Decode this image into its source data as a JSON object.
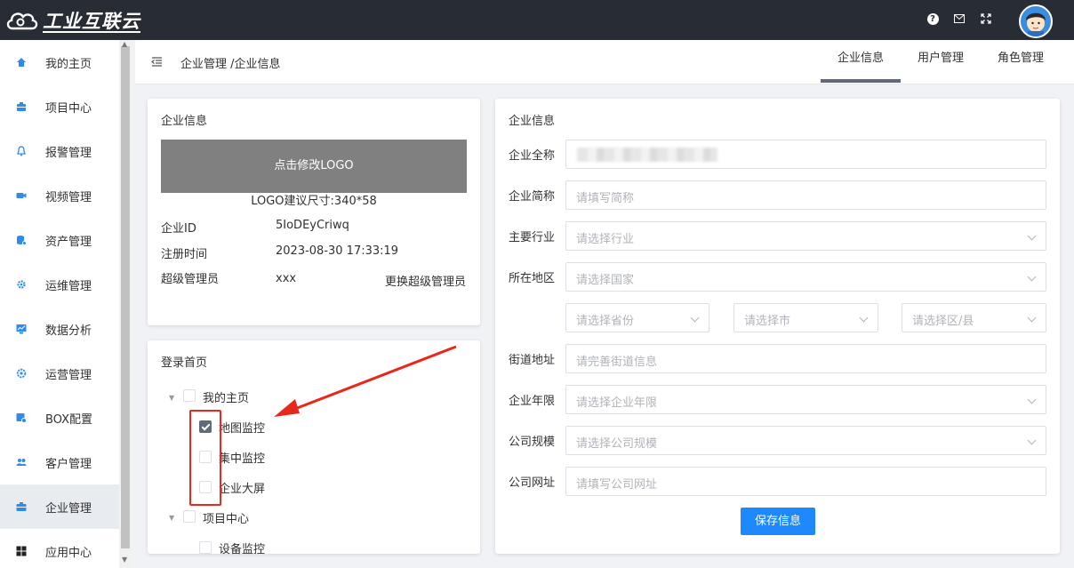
{
  "topbar": {
    "brand": "工业互联云",
    "icons": [
      "help-icon",
      "mail-icon",
      "fullscreen-icon"
    ]
  },
  "sidebar": {
    "items": [
      {
        "label": "我的主页",
        "icon": "home-icon"
      },
      {
        "label": "项目中心",
        "icon": "briefcase-icon"
      },
      {
        "label": "报警管理",
        "icon": "bell-icon"
      },
      {
        "label": "视频管理",
        "icon": "video-icon"
      },
      {
        "label": "资产管理",
        "icon": "database-icon"
      },
      {
        "label": "运维管理",
        "icon": "gear-icon"
      },
      {
        "label": "数据分析",
        "icon": "chart-icon"
      },
      {
        "label": "运营管理",
        "icon": "settings-icon"
      },
      {
        "label": "BOX配置",
        "icon": "box-icon"
      },
      {
        "label": "客户管理",
        "icon": "users-icon"
      },
      {
        "label": "企业管理",
        "icon": "company-icon"
      },
      {
        "label": "应用中心",
        "icon": "grid-icon"
      }
    ],
    "active_index": 10
  },
  "header": {
    "breadcrumb": "企业管理 /企业信息",
    "tabs": [
      {
        "label": "企业信息"
      },
      {
        "label": "用户管理"
      },
      {
        "label": "角色管理"
      }
    ],
    "active_tab": 0
  },
  "company_card": {
    "title": "企业信息",
    "logo_button": "点击修改LOGO",
    "logo_hint": "LOGO建议尺寸:340*58",
    "id_label": "企业ID",
    "id_value": "5IoDEyCriwq",
    "reg_label": "注册时间",
    "reg_value": "2023-08-30 17:33:19",
    "admin_label": "超级管理员",
    "admin_value": "xxx",
    "change_admin": "更换超级管理员"
  },
  "login_home": {
    "title": "登录首页",
    "tree": [
      {
        "label": "我的主页",
        "checked": false,
        "children": [
          {
            "label": "地图监控",
            "checked": true
          },
          {
            "label": "集中监控",
            "checked": false
          },
          {
            "label": "企业大屏",
            "checked": false
          }
        ]
      },
      {
        "label": "项目中心",
        "checked": false,
        "children": [
          {
            "label": "设备监控",
            "checked": false
          }
        ]
      }
    ]
  },
  "form": {
    "title": "企业信息",
    "full_name_label": "企业全称",
    "short_name_label": "企业简称",
    "short_name_placeholder": "请填写简称",
    "industry_label": "主要行业",
    "industry_placeholder": "请选择行业",
    "region_label": "所在地区",
    "country_placeholder": "请选择国家",
    "province_placeholder": "请选择省份",
    "city_placeholder": "请选择市",
    "district_placeholder": "请选择区/县",
    "street_label": "街道地址",
    "street_placeholder": "请完善街道信息",
    "years_label": "企业年限",
    "years_placeholder": "请选择企业年限",
    "scale_label": "公司规模",
    "scale_placeholder": "请选择公司规模",
    "website_label": "公司网址",
    "website_placeholder": "请填写公司网址",
    "save_button": "保存信息"
  },
  "colors": {
    "topbar": "#282c34",
    "primary_button": "#1e88ff",
    "annotation": "#e8281a",
    "active_tab_bar": "#606a78"
  }
}
